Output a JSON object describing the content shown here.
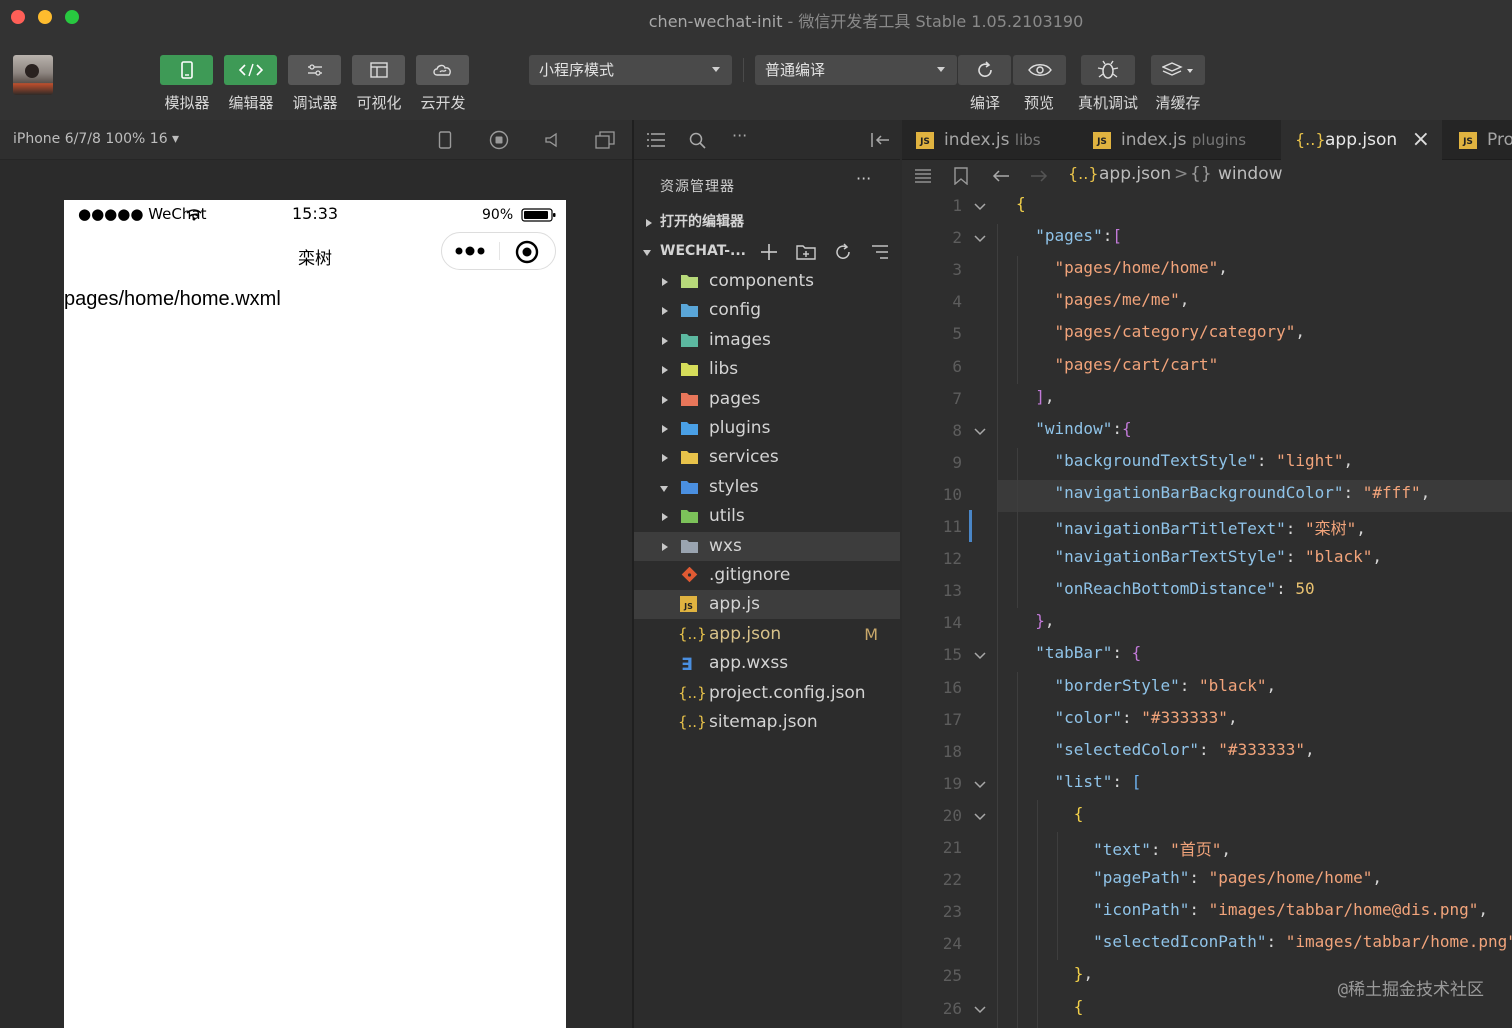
{
  "window": {
    "title": "chen-wechat-init",
    "separator": " - ",
    "subtitle": "微信开发者工具 Stable 1.05.2103190"
  },
  "toolbar": {
    "buttons": [
      {
        "label": "模拟器",
        "icon": "phone-icon"
      },
      {
        "label": "编辑器",
        "icon": "code-icon"
      },
      {
        "label": "调试器",
        "icon": "sliders-icon"
      },
      {
        "label": "可视化",
        "icon": "layout-icon"
      },
      {
        "label": "云开发",
        "icon": "cloud-icon"
      }
    ],
    "mode_select": "小程序模式",
    "compile_select": "普通编译",
    "actions": [
      {
        "label": "编译",
        "icon": "refresh-icon"
      },
      {
        "label": "预览",
        "icon": "eye-icon"
      },
      {
        "label": "真机调试",
        "icon": "bug-icon"
      },
      {
        "label": "清缓存",
        "icon": "layers-icon"
      }
    ]
  },
  "simulator": {
    "device": "iPhone 6/7/8 100% 16 ▾",
    "status": {
      "carrier": "●●●●● WeChat",
      "time": "15:33",
      "battery": "90%"
    },
    "nav_title": "栾树",
    "page_path": "pages/home/home.wxml"
  },
  "explorer": {
    "title": "资源管理器",
    "more": "···",
    "open_editors": "打开的编辑器",
    "project": "WECHAT-...",
    "items": [
      {
        "name": "components",
        "type": "folder",
        "color": "#b7d97a"
      },
      {
        "name": "config",
        "type": "folder",
        "color": "#5aa6d8"
      },
      {
        "name": "images",
        "type": "folder",
        "color": "#5cb8a0"
      },
      {
        "name": "libs",
        "type": "folder",
        "color": "#d6dd5a"
      },
      {
        "name": "pages",
        "type": "folder",
        "color": "#e8765a"
      },
      {
        "name": "plugins",
        "type": "folder",
        "color": "#4aa0e6"
      },
      {
        "name": "services",
        "type": "folder",
        "color": "#e8c24a"
      },
      {
        "name": "styles",
        "type": "folder",
        "color": "#4a8fe0",
        "open": true
      },
      {
        "name": "utils",
        "type": "folder",
        "color": "#7cc25a"
      },
      {
        "name": "wxs",
        "type": "folder",
        "color": "#9aa4b0"
      },
      {
        "name": ".gitignore",
        "type": "git"
      },
      {
        "name": "app.js",
        "type": "js"
      },
      {
        "name": "app.json",
        "type": "json",
        "badge": "M"
      },
      {
        "name": "app.wxss",
        "type": "css"
      },
      {
        "name": "project.config.json",
        "type": "json"
      },
      {
        "name": "sitemap.json",
        "type": "json"
      }
    ]
  },
  "tabs": [
    {
      "name": "index.js",
      "hint": "libs"
    },
    {
      "name": "index.js",
      "hint": "plugins"
    },
    {
      "name": "app.json",
      "hint": "",
      "close": "×"
    },
    {
      "name": "Pro",
      "hint": ""
    }
  ],
  "breadcrumb": {
    "file": "app.json",
    "sep": ">",
    "node": "window",
    "json_icon": "{..}",
    "obj_icon": "{}"
  },
  "code_lines": [
    {
      "n": "1",
      "html": "<span class='b1'>{</span>"
    },
    {
      "n": "2",
      "html": "  <span class='k'>\"pages\"</span><span class='p'>:</span><span class='b2'>[</span>"
    },
    {
      "n": "3",
      "html": "    <span class='s'>\"pages/home/home\"</span><span class='p'>,</span>"
    },
    {
      "n": "4",
      "html": "    <span class='s'>\"pages/me/me\"</span><span class='p'>,</span>"
    },
    {
      "n": "5",
      "html": "    <span class='s'>\"pages/category/category\"</span><span class='p'>,</span>"
    },
    {
      "n": "6",
      "html": "    <span class='s'>\"pages/cart/cart\"</span>"
    },
    {
      "n": "7",
      "html": "  <span class='b2'>]</span><span class='p'>,</span>"
    },
    {
      "n": "8",
      "html": "  <span class='k'>\"window\"</span><span class='p'>:</span><span class='b2'>{</span>"
    },
    {
      "n": "9",
      "html": "    <span class='k'>\"backgroundTextStyle\"</span><span class='p'>: </span><span class='s'>\"light\"</span><span class='p'>,</span>"
    },
    {
      "n": "10",
      "html": "    <span class='k'>\"navigationBarBackgroundColor\"</span><span class='p'>: </span><span class='s'>\"#fff\"</span><span class='p'>,</span>"
    },
    {
      "n": "11",
      "html": "    <span class='k'>\"navigationBarTitleText\"</span><span class='p'>: </span><span class='s'>\"栾树\"</span><span class='p'>,</span>"
    },
    {
      "n": "12",
      "html": "    <span class='k'>\"navigationBarTextStyle\"</span><span class='p'>: </span><span class='s'>\"black\"</span><span class='p'>,</span>"
    },
    {
      "n": "13",
      "html": "    <span class='k'>\"onReachBottomDistance\"</span><span class='p'>: </span><span class='n'>50</span>"
    },
    {
      "n": "14",
      "html": "  <span class='b2'>}</span><span class='p'>,</span>"
    },
    {
      "n": "15",
      "html": "  <span class='k'>\"tabBar\"</span><span class='p'>: </span><span class='b2'>{</span>"
    },
    {
      "n": "16",
      "html": "    <span class='k'>\"borderStyle\"</span><span class='p'>: </span><span class='s'>\"black\"</span><span class='p'>,</span>"
    },
    {
      "n": "17",
      "html": "    <span class='k'>\"color\"</span><span class='p'>: </span><span class='s'>\"#333333\"</span><span class='p'>,</span>"
    },
    {
      "n": "18",
      "html": "    <span class='k'>\"selectedColor\"</span><span class='p'>: </span><span class='s'>\"#333333\"</span><span class='p'>,</span>"
    },
    {
      "n": "19",
      "html": "    <span class='k'>\"list\"</span><span class='p'>: </span><span class='b3'>[</span>"
    },
    {
      "n": "20",
      "html": "      <span class='b1'>{</span>"
    },
    {
      "n": "21",
      "html": "        <span class='k'>\"text\"</span><span class='p'>: </span><span class='s'>\"首页\"</span><span class='p'>,</span>"
    },
    {
      "n": "22",
      "html": "        <span class='k'>\"pagePath\"</span><span class='p'>: </span><span class='s'>\"pages/home/home\"</span><span class='p'>,</span>"
    },
    {
      "n": "23",
      "html": "        <span class='k'>\"iconPath\"</span><span class='p'>: </span><span class='s'>\"images/tabbar/home@dis.png\"</span><span class='p'>,</span>"
    },
    {
      "n": "24",
      "html": "        <span class='k'>\"selectedIconPath\"</span><span class='p'>: </span><span class='s'>\"images/tabbar/home.png\"</span>"
    },
    {
      "n": "25",
      "html": "      <span class='b1'>}</span><span class='p'>,</span>"
    },
    {
      "n": "26",
      "html": "      <span class='b1'>{</span>"
    }
  ],
  "watermark": "@稀土掘金技术社区",
  "colors": {
    "accent_green": "#3e9a56",
    "string": "#f2a47b",
    "key": "#8fc3e8",
    "number": "#e8c170",
    "modified": "#c9a86a"
  }
}
